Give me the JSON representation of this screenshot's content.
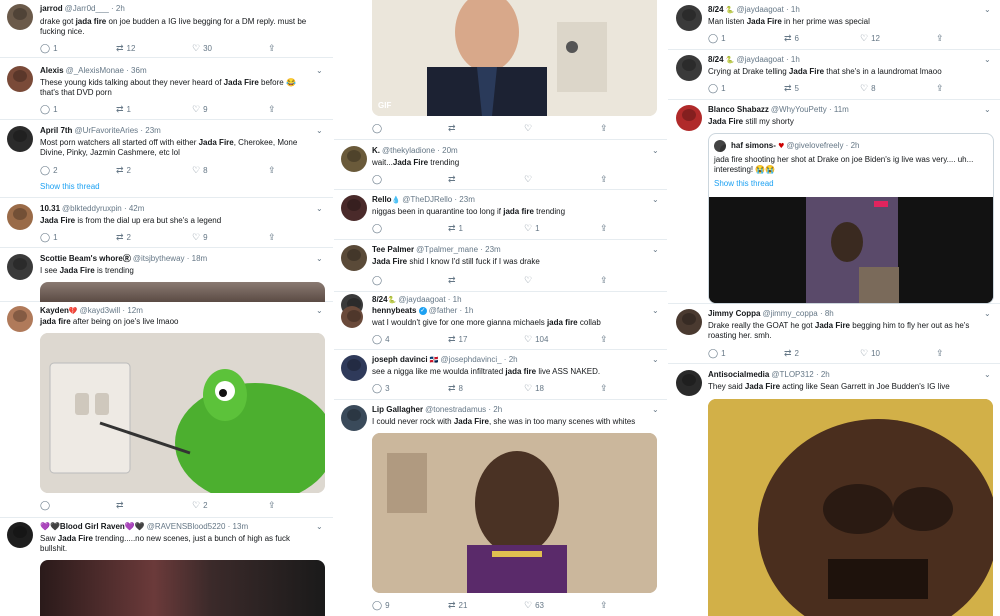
{
  "col1": {
    "t1": {
      "name": "jarrod",
      "handle": "@Jarr0d___ · 2h",
      "l1a": "drake got ",
      "l1b": "jada fire",
      "l1c": " on joe budden a IG live begging for a DM reply. must be",
      "l2": "fucking nice.",
      "reply": "1",
      "rt": "12",
      "like": "30"
    },
    "t2": {
      "name": "Alexis",
      "handle": "@_AlexisMonae · 36m",
      "l1a": "These young kids talking about they never heard of ",
      "l1b": "Jada Fire",
      "l1c": " before 😂",
      "l2": "that's that DVD porn",
      "reply": "1",
      "rt": "1",
      "like": "9"
    },
    "t3": {
      "name": "April 7th",
      "handle": "@UrFavoriteAries · 23m",
      "l1a": "Most porn watchers all started off with either ",
      "l1b": "Jada Fire",
      "l1c": ", Cherokee, Mone",
      "l2": "Divine, Pinky, Jazmin Cashmere, etc lol",
      "thread": "Show this thread",
      "reply": "2",
      "rt": "2",
      "like": "8"
    },
    "t4": {
      "name": "10.31",
      "handle": "@blkteddyruxpin · 42m",
      "l1b": "Jada Fire",
      "l1c": " is from the dial up era but she's a legend",
      "reply": "1",
      "rt": "2",
      "like": "9"
    },
    "t5": {
      "name": "Scottie Beam's whoreⓇ",
      "handle": "@itsjbytheway · 18m",
      "l1a": "I see ",
      "l1b": "Jada Fire",
      "l1c": " is trending"
    },
    "t6": {
      "name": "Kayden",
      "handle": "@kayd3will · 12m",
      "l1b": "jada fire",
      "l1c": " after being on joe's live lmaoo",
      "like": "2"
    },
    "t7": {
      "name": "💜🖤Blood Girl Raven💜🖤",
      "handle": "@RAVENSBlood5220 · 13m",
      "l1a": "Saw ",
      "l1b": "Jada Fire",
      "l1c": " trending.....no new scenes, just a bunch of high as fuck",
      "l2": "bullshit."
    }
  },
  "col2": {
    "gif": "GIF",
    "t1": {
      "name": "K.",
      "handle": "@thekyladione · 20m",
      "l1a": "wait...",
      "l1b": "Jada Fire",
      "l1c": " trending"
    },
    "t2": {
      "name": "Rello",
      "handle": "@TheDJRello · 23m",
      "l1a": "niggas been in quarantine too long if ",
      "l1b": "jada fire",
      "l1c": " trending",
      "rt": "1",
      "like": "1"
    },
    "t3": {
      "name": "Tee Palmer",
      "handle": "@Tpalmer_mane · 23m",
      "l1b": "Jada Fire",
      "l1c": " shid I know I'd still fuck if I was drake"
    },
    "t4": {
      "name": "8/24",
      "handle": "@jaydaagoat · 1h",
      "sub": "hennybeats",
      "subhandle": "@father · 1h",
      "l1a": "wat I wouldn't give for one more gianna michaels ",
      "l1b": "jada fire",
      "l1c": " collab",
      "reply": "4",
      "rt": "17",
      "like": "104"
    },
    "t5": {
      "name": "joseph davinci",
      "handle": "@josephdavinci_ · 2h",
      "l1a": "see a nigga like me woulda infiltrated ",
      "l1b": "jada fire",
      "l1c": " live ASS NAKED.",
      "reply": "3",
      "rt": "8",
      "like": "18"
    },
    "t6": {
      "name": "Lip Gallagher",
      "handle": "@tonestradamus · 2h",
      "l1a": "I could never rock with ",
      "l1b": "Jada Fire",
      "l1c": ", she was in too many scenes with whites",
      "reply": "9",
      "rt": "21",
      "like": "63"
    }
  },
  "col3": {
    "t1": {
      "name": "8/24",
      "handle": "@jaydaagoat · 1h",
      "l1a": "Man listen ",
      "l1b": "Jada Fire",
      "l1c": " in her prime was special",
      "reply": "1",
      "rt": "6",
      "like": "12"
    },
    "t2": {
      "name": "8/24",
      "handle": "@jaydaagoat · 1h",
      "l1a": "Crying at Drake telling ",
      "l1b": "Jada Fire",
      "l1c": " that she's in a laundromat lmaoo",
      "reply": "1",
      "rt": "5",
      "like": "8"
    },
    "t3": {
      "name": "Blanco Shabazz",
      "handle": "@WhyYouPetty · 11m",
      "l1b": "Jada Fire",
      "l1c": " still my shorty",
      "quote": {
        "name": "haf simons-",
        "handle": "@givelovefreely · 2h",
        "l1": "jada fire shooting her shot at Drake on joe Biden's ig live was very.... uh...",
        "l2": "interesting! 😭😭",
        "thread": "Show this thread"
      }
    },
    "t4": {
      "name": "Jimmy Coppa",
      "handle": "@jimmy_coppa · 8h",
      "l1a": "Drake really the GOAT he got ",
      "l1b": "Jada Fire",
      "l1c": " begging him to fly her out as he's",
      "l2": "roasting her. smh.",
      "reply": "1",
      "rt": "2",
      "like": "10"
    },
    "t5": {
      "name": "Antisocialmedia",
      "handle": "@TLOP312 · 2h",
      "l1a": "They said ",
      "l1b": "Jada Fire",
      "l1c": " acting like Sean Garrett in Joe Budden's IG live"
    }
  }
}
